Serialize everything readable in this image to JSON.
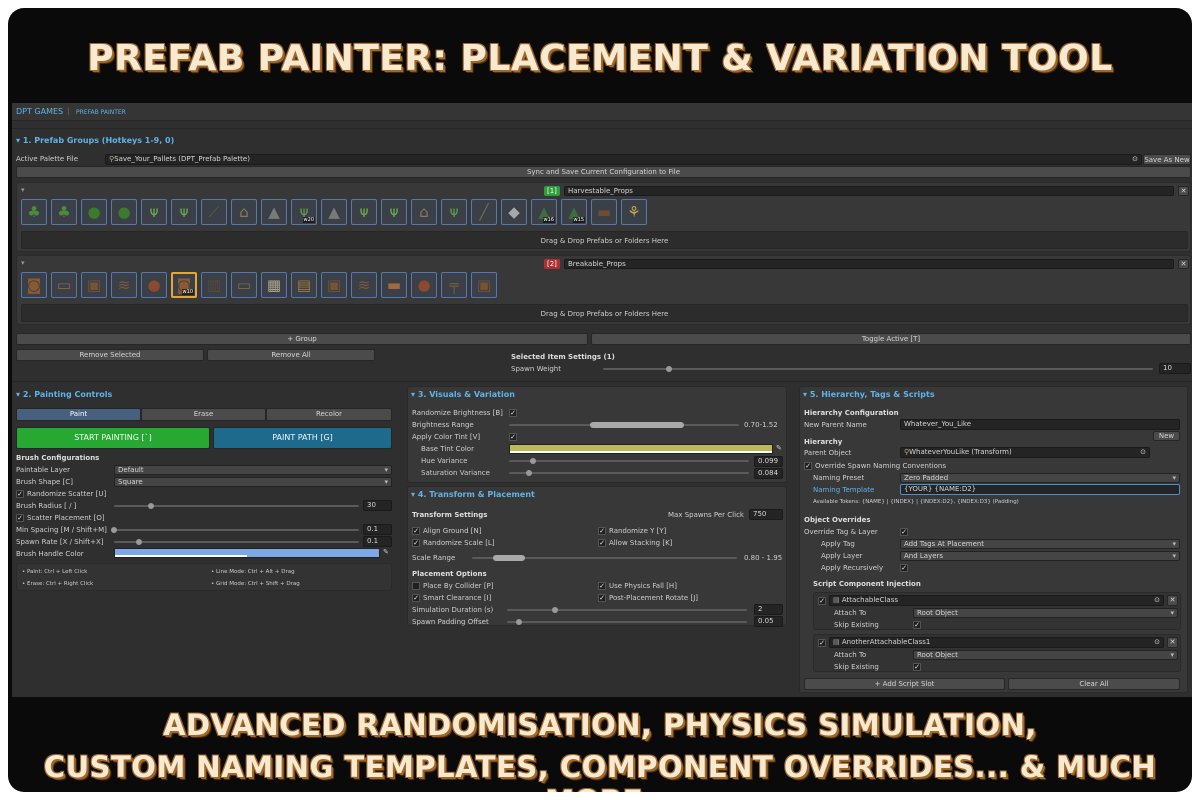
{
  "banner": {
    "title": "PREFAB PAINTER: PLACEMENT & VARIATION TOOL",
    "bottom_line1": "ADVANCED RANDOMISATION, PHYSICS SIMULATION,",
    "bottom_line2": "CUSTOM NAMING TEMPLATES, COMPONENT OVERRIDES... & MUCH MORE."
  },
  "editor": {
    "breadcrumb": {
      "root": "DPT GAMES",
      "separator": "|",
      "page": "PREFAB PAINTER"
    },
    "groups_section": {
      "header": "1. Prefab Groups (Hotkeys 1-9, 0)",
      "active_palette_label": "Active Palette File",
      "active_palette_value": "Save_Your_Pallets (DPT_Prefab Palette)",
      "save_as_new": "Save As New",
      "sync_button": "Sync and Save Current Configuration to File",
      "groups": [
        {
          "index_badge": "[1]",
          "badge_color": "#2e9e3b",
          "name": "Harvestable_Props",
          "drop_hint": "Drag & Drop Prefabs or Folders Here",
          "items": [
            {
              "icon": "tree-icon",
              "weight": ""
            },
            {
              "icon": "tree-icon",
              "weight": ""
            },
            {
              "icon": "bush-icon",
              "weight": ""
            },
            {
              "icon": "bush-icon",
              "weight": ""
            },
            {
              "icon": "grass-icon",
              "weight": ""
            },
            {
              "icon": "grass-icon",
              "weight": ""
            },
            {
              "icon": "branch-icon",
              "weight": ""
            },
            {
              "icon": "mushroom-icon",
              "weight": ""
            },
            {
              "icon": "rock-icon",
              "weight": ""
            },
            {
              "icon": "fern-icon",
              "weight": "w20"
            },
            {
              "icon": "rock-icon",
              "weight": ""
            },
            {
              "icon": "grass-icon",
              "weight": ""
            },
            {
              "icon": "grass-icon",
              "weight": ""
            },
            {
              "icon": "mushroom-icon",
              "weight": ""
            },
            {
              "icon": "fern-icon",
              "weight": ""
            },
            {
              "icon": "stick-icon",
              "weight": ""
            },
            {
              "icon": "stone-icon",
              "weight": ""
            },
            {
              "icon": "pine-icon",
              "weight": "w16"
            },
            {
              "icon": "pine-icon",
              "weight": "w15"
            },
            {
              "icon": "stump-icon",
              "weight": ""
            },
            {
              "icon": "wheat-icon",
              "weight": ""
            }
          ]
        },
        {
          "index_badge": "[2]",
          "badge_color": "#b03030",
          "name": "Breakable_Props",
          "drop_hint": "Drag & Drop Prefabs or Folders Here",
          "items": [
            {
              "icon": "barrel-icon",
              "weight": ""
            },
            {
              "icon": "plank-icon",
              "weight": ""
            },
            {
              "icon": "crate-icon",
              "weight": ""
            },
            {
              "icon": "debris-icon",
              "weight": ""
            },
            {
              "icon": "pot-icon",
              "weight": ""
            },
            {
              "icon": "barrel-icon",
              "weight": "w10"
            },
            {
              "icon": "planks-icon",
              "weight": ""
            },
            {
              "icon": "plank-icon",
              "weight": ""
            },
            {
              "icon": "cage-icon",
              "weight": ""
            },
            {
              "icon": "chest-icon",
              "weight": ""
            },
            {
              "icon": "crate-icon",
              "weight": ""
            },
            {
              "icon": "debris-icon",
              "weight": ""
            },
            {
              "icon": "board-icon",
              "weight": ""
            },
            {
              "icon": "pot-icon",
              "weight": ""
            },
            {
              "icon": "bench-icon",
              "weight": ""
            },
            {
              "icon": "crate-icon",
              "weight": ""
            }
          ]
        }
      ],
      "add_group": "+ Group",
      "toggle_active": "Toggle Active [T]",
      "remove_selected": "Remove Selected",
      "remove_all": "Remove All",
      "selected_item_header": "Selected Item Settings (1)",
      "spawn_weight_label": "Spawn Weight",
      "spawn_weight_value": "10",
      "spawn_weight_fraction": 0.12
    },
    "painting": {
      "header": "2. Painting Controls",
      "tabs": [
        "Paint",
        "Erase",
        "Recolor"
      ],
      "active_tab": 0,
      "start_painting": "START PAINTING [`]",
      "paint_path": "PAINT PATH [G]",
      "brush_configs": "Brush Configurations",
      "paintable_layer_label": "Paintable Layer",
      "paintable_layer_value": "Default",
      "brush_shape_label": "Brush Shape [C]",
      "brush_shape_value": "Square",
      "randomize_scatter": "Randomize Scatter [U]",
      "brush_radius_label": "Brush Radius [ / ]",
      "brush_radius_value": "30",
      "brush_radius_fraction": 0.15,
      "scatter_placement": "Scatter Placement [O]",
      "min_spacing_label": "Min Spacing [M / Shift+M]",
      "min_spacing_value": "0.1",
      "min_spacing_fraction": 0.0,
      "spawn_rate_label": "Spawn Rate [X / Shift+X]",
      "spawn_rate_value": "0.1",
      "spawn_rate_fraction": 0.1,
      "brush_handle_color_label": "Brush Handle Color",
      "brush_handle_color": "#7ea7e6",
      "hints": [
        "• Paint: Ctrl + Left Click",
        "• Line Mode: Ctrl + Alt + Drag",
        "• Erase: Ctrl + Right Click",
        "• Grid Mode: Ctrl + Shift + Drag"
      ]
    },
    "visuals": {
      "header": "3. Visuals & Variation",
      "randomize_brightness": "Randomize Brightness [B]",
      "brightness_range_label": "Brightness Range",
      "brightness_range_value": "0.70-1.52",
      "brightness_range_fraction": [
        0.35,
        0.76
      ],
      "apply_color_tint": "Apply Color Tint [V]",
      "base_tint_label": "Base Tint Color",
      "base_tint_color": "#bfb85a",
      "hue_variance_label": "Hue Variance",
      "hue_variance_value": "0.099",
      "hue_variance_fraction": 0.099,
      "saturation_variance_label": "Saturation Variance",
      "saturation_variance_value": "0.084",
      "saturation_variance_fraction": 0.084
    },
    "transform": {
      "header": "4. Transform & Placement",
      "settings_label": "Transform Settings",
      "max_spawns_label": "Max Spawns Per Click",
      "max_spawns_value": "750",
      "align_ground": "Align Ground [N]",
      "randomize_y": "Randomize Y [Y]",
      "randomize_scale": "Randomize Scale [L]",
      "allow_stacking": "Allow Stacking [K]",
      "scale_range_label": "Scale Range",
      "scale_range_value": "0.80 - 1.95",
      "scale_range_fraction": [
        0.08,
        0.2
      ],
      "placement_options": "Placement Options",
      "place_by_collider": "Place By Collider [P]",
      "use_physics_fall": "Use Physics Fall [H]",
      "smart_clearance": "Smart Clearance [I]",
      "post_placement_rotate": "Post-Placement Rotate [J]",
      "simulation_duration_label": "Simulation Duration (s)",
      "simulation_duration_value": "2",
      "simulation_duration_fraction": 0.2,
      "spawn_padding_label": "Spawn Padding Offset",
      "spawn_padding_value": "0.05",
      "spawn_padding_fraction": 0.05
    },
    "hierarchy": {
      "header": "5. Hierarchy, Tags & Scripts",
      "config_label": "Hierarchy Configuration",
      "new_parent_label": "New Parent Name",
      "new_parent_value": "Whatever_You_Like",
      "new_button": "New",
      "hierarchy_label": "Hierarchy",
      "parent_object_label": "Parent Object",
      "parent_object_value": "WhateverYouLike (Transform)",
      "override_naming": "Override Spawn Naming Conventions",
      "naming_preset_label": "Naming Preset",
      "naming_preset_value": "Zero Padded",
      "naming_template_label": "Naming Template",
      "naming_template_value": "{YOUR} {NAME:D2}",
      "tokens": "Available Tokens: {NAME}  |  {INDEX}  |  {INDEX:D2}, {INDEX:D3} (Padding)",
      "object_overrides": "Object Overrides",
      "override_tag_layer": "Override Tag & Layer",
      "apply_tag_label": "Apply Tag",
      "apply_tag_value": "Add Tags At Placement",
      "apply_layer_label": "Apply Layer",
      "apply_layer_value": "And Layers",
      "apply_recursively_label": "Apply Recursively",
      "script_injection": "Script Component Injection",
      "scripts": [
        {
          "name": "AttachableClass",
          "attach_to_label": "Attach To",
          "attach_to_value": "Root Object",
          "skip_existing_label": "Skip Existing"
        },
        {
          "name": "AnotherAttachableClass1",
          "attach_to_label": "Attach To",
          "attach_to_value": "Root Object",
          "skip_existing_label": "Skip Existing"
        }
      ],
      "add_script_slot": "+ Add Script Slot",
      "clear_all": "Clear All"
    }
  }
}
